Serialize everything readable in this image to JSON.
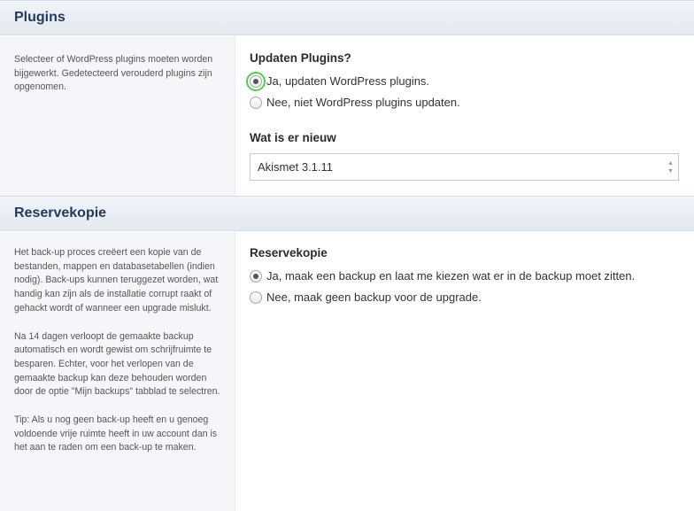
{
  "plugins": {
    "header": "Plugins",
    "description": "Selecteer of WordPress plugins moeten worden bijgewerkt. Gedetecteerd verouderd plugins zijn opgenomen.",
    "question": "Updaten Plugins?",
    "options": [
      {
        "label": "Ja, updaten WordPress plugins.",
        "checked": true
      },
      {
        "label": "Nee, niet WordPress plugins updaten.",
        "checked": false
      }
    ],
    "whats_new_title": "Wat is er nieuw",
    "whats_new_value": "Akismet 3.1.11"
  },
  "backup": {
    "header": "Reservekopie",
    "description": [
      "Het back-up proces creëert een kopie van de bestanden, mappen en databasetabellen (indien nodig). Back-ups kunnen teruggezet worden, wat handig kan zijn als de installatie corrupt raakt of gehackt wordt of wanneer een upgrade mislukt.",
      "Na 14 dagen verloopt de gemaakte backup automatisch en wordt gewist om schrijfruimte te besparen. Echter, voor het verlopen van de gemaakte backup kan deze behouden worden door de optie \"Mijn backups\" tabblad te selectren.",
      "Tip: Als u nog geen back-up heeft en u genoeg voldoende vrije ruimte heeft in uw account dan is het aan te raden om een back-up te maken."
    ],
    "question": "Reservekopie",
    "options": [
      {
        "label": "Ja, maak een backup en laat me kiezen wat er in de backup moet zitten.",
        "checked": true
      },
      {
        "label": "Nee, maak geen backup voor de upgrade.",
        "checked": false
      }
    ]
  },
  "icons": {
    "spinner_up": "▲",
    "spinner_down": "▼"
  },
  "colors": {
    "header_text": "#1f3a5f",
    "focus_ring": "#4cd24c",
    "panel_bg": "#f4f6fa"
  }
}
